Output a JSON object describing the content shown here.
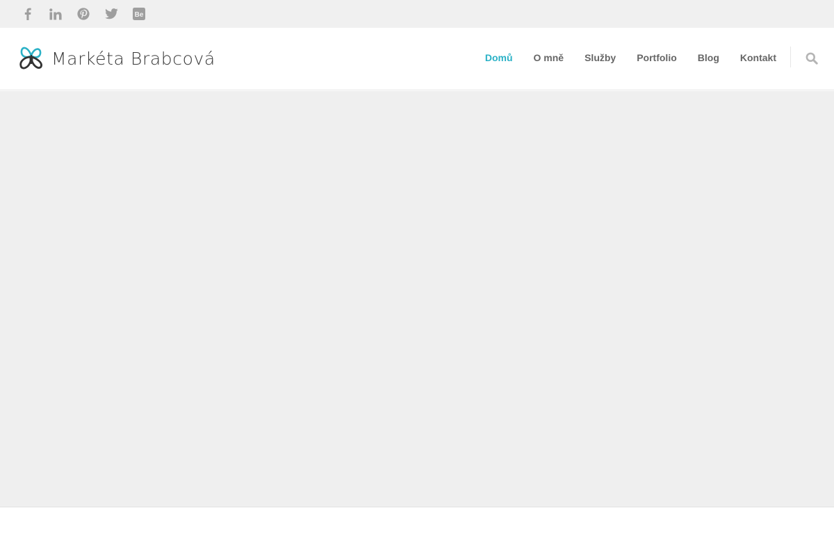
{
  "site": {
    "logo_text": "Markéta Brabcová"
  },
  "social": [
    {
      "name": "facebook",
      "icon": "facebook-icon"
    },
    {
      "name": "linkedin",
      "icon": "linkedin-icon"
    },
    {
      "name": "pinterest",
      "icon": "pinterest-icon"
    },
    {
      "name": "twitter",
      "icon": "twitter-icon"
    },
    {
      "name": "behance",
      "icon": "behance-icon"
    }
  ],
  "nav": {
    "items": [
      {
        "label": "Domů",
        "active": true
      },
      {
        "label": "O mně",
        "active": false
      },
      {
        "label": "Služby",
        "active": false
      },
      {
        "label": "Portfolio",
        "active": false
      },
      {
        "label": "Blog",
        "active": false
      },
      {
        "label": "Kontakt",
        "active": false
      }
    ],
    "search_icon": "search-icon"
  },
  "colors": {
    "accent": "#2ab1c6",
    "nav_text": "#666666",
    "icon_gray": "#9e9e9e",
    "topbar_bg": "#f0f0f0",
    "hero_bg": "#efefef"
  }
}
